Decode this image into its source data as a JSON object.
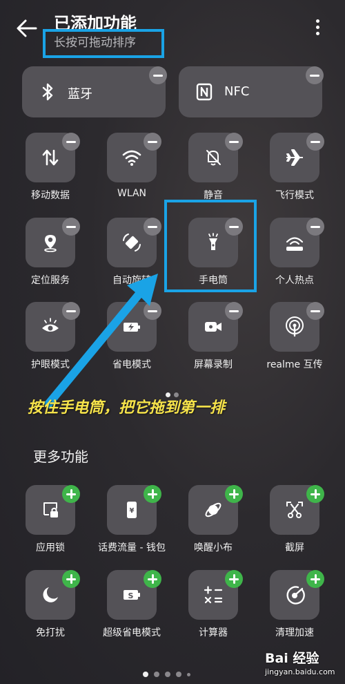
{
  "header": {
    "title": "已添加功能",
    "subtitle": "长按可拖动排序",
    "back_icon": "arrow-left-icon",
    "more_icon": "more-vertical-icon"
  },
  "added_tiles": [
    {
      "label": "蓝牙",
      "icon": "bluetooth-icon"
    },
    {
      "label": "NFC",
      "icon": "nfc-icon"
    },
    {
      "label": "移动数据",
      "icon": "mobile-data-icon"
    },
    {
      "label": "WLAN",
      "icon": "wifi-icon"
    },
    {
      "label": "静音",
      "icon": "bell-off-icon"
    },
    {
      "label": "飞行模式",
      "icon": "airplane-icon"
    },
    {
      "label": "定位服务",
      "icon": "location-icon"
    },
    {
      "label": "自动旋转",
      "icon": "rotate-icon"
    },
    {
      "label": "手电筒",
      "icon": "flashlight-icon"
    },
    {
      "label": "个人热点",
      "icon": "hotspot-icon"
    },
    {
      "label": "护眼模式",
      "icon": "eye-icon"
    },
    {
      "label": "省电模式",
      "icon": "battery-saver-icon"
    },
    {
      "label": "屏幕录制",
      "icon": "screen-record-icon"
    },
    {
      "label": "realme 互传",
      "icon": "share-signal-icon"
    }
  ],
  "page_indicator_top": {
    "count": 2,
    "active": 1
  },
  "annotation": {
    "instruction": "按住手电筒，把它拖到第一排",
    "highlight_color": "#1aa3e6",
    "text_color": "#f6e34a"
  },
  "more_section": {
    "title": "更多功能",
    "tiles": [
      {
        "label": "应用锁",
        "icon": "app-lock-icon"
      },
      {
        "label": "话费流量 - 钱包",
        "icon": "wallet-phone-icon"
      },
      {
        "label": "唤醒小布",
        "icon": "assistant-icon"
      },
      {
        "label": "截屏",
        "icon": "screenshot-icon"
      },
      {
        "label": "免打扰",
        "icon": "moon-icon"
      },
      {
        "label": "超级省电模式",
        "icon": "super-saver-icon"
      },
      {
        "label": "计算器",
        "icon": "calculator-icon"
      },
      {
        "label": "清理加速",
        "icon": "clean-boost-icon"
      }
    ]
  },
  "page_indicator_bottom": {
    "count": 5,
    "active": 0
  },
  "watermark": {
    "brand": "Bai 经验",
    "url": "jingyan.baidu.com"
  },
  "colors": {
    "background": "#2c2a2e",
    "tile": "#545257",
    "remove_badge": "#7b797e",
    "add_badge": "#3fb54a"
  }
}
